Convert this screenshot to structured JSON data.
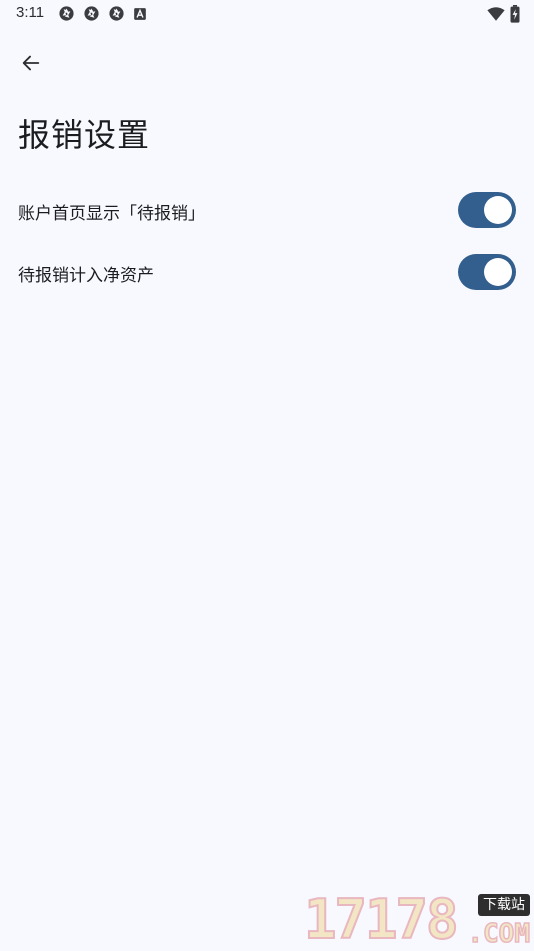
{
  "status_bar": {
    "time": "3:11",
    "left_icons": [
      "aperture-icon",
      "aperture-icon",
      "aperture-icon",
      "font-a-icon"
    ],
    "right_icons": [
      "wifi-icon",
      "battery-charging-icon"
    ]
  },
  "header": {
    "back_icon": "arrow-left-icon",
    "title": "报销设置"
  },
  "settings": [
    {
      "label": "账户首页显示「待报销」",
      "enabled": true
    },
    {
      "label": "待报销计入净资产",
      "enabled": true
    }
  ],
  "colors": {
    "background": "#f8f9ff",
    "switch_track": "#335f8f",
    "switch_thumb": "#ffffff",
    "text": "#1b1c1f"
  },
  "watermark": {
    "digits": "17178",
    "badge": "下载站",
    "domain": ".COM"
  }
}
